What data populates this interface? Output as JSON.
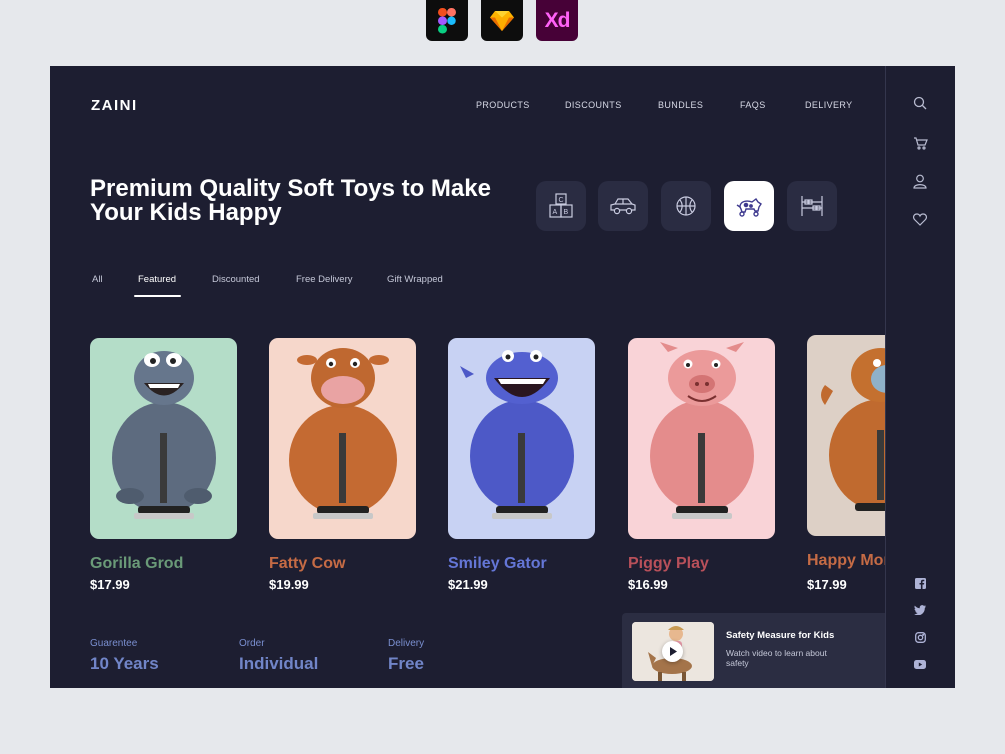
{
  "tools": [
    "figma-icon",
    "sketch-icon",
    "adobe-xd-icon"
  ],
  "tools_xd_label": "Xd",
  "brand": {
    "logo": "ZAINI"
  },
  "nav": [
    "PRODUCTS",
    "DISCOUNTS",
    "BUNDLES",
    "FAQS",
    "DELIVERY"
  ],
  "hero": {
    "title": "Premium Quality Soft Toys to Make Your Kids Happy"
  },
  "categories": [
    {
      "icon": "abc-blocks-icon",
      "active": false
    },
    {
      "icon": "toy-car-icon",
      "active": false
    },
    {
      "icon": "ball-icon",
      "active": false
    },
    {
      "icon": "toy-animal-icon",
      "active": true
    },
    {
      "icon": "abacus-icon",
      "active": false
    }
  ],
  "filters": [
    "All",
    "Featured",
    "Discounted",
    "Free Delivery",
    "Gift Wrapped"
  ],
  "active_filter": "Featured",
  "products": [
    {
      "name": "Gorilla Grod",
      "price": "$17.99",
      "color": "#6a9a78",
      "bg": "#b4ddc8"
    },
    {
      "name": "Fatty Cow",
      "price": "$19.99",
      "color": "#c56b45",
      "bg": "#f6d7cb"
    },
    {
      "name": "Smiley Gator",
      "price": "$21.99",
      "color": "#6476d6",
      "bg": "#c8d2f3"
    },
    {
      "name": "Piggy Play",
      "price": "$16.99",
      "color": "#b8505a",
      "bg": "#f9d3d7"
    },
    {
      "name": "Happy Monkey",
      "price": "$17.99",
      "color": "#c56b45",
      "bg": "#ddd0c6"
    }
  ],
  "stats": [
    {
      "label": "Guarentee",
      "value": "10 Years"
    },
    {
      "label": "Order",
      "value": "Individual"
    },
    {
      "label": "Delivery",
      "value": "Free"
    }
  ],
  "safety": {
    "title": "Safety Measure for Kids",
    "description": "Watch video to learn about safety"
  },
  "rail_icons": [
    "search-icon",
    "cart-icon",
    "user-icon",
    "heart-icon"
  ],
  "social_icons": [
    "facebook-icon",
    "twitter-icon",
    "instagram-icon",
    "youtube-icon"
  ]
}
